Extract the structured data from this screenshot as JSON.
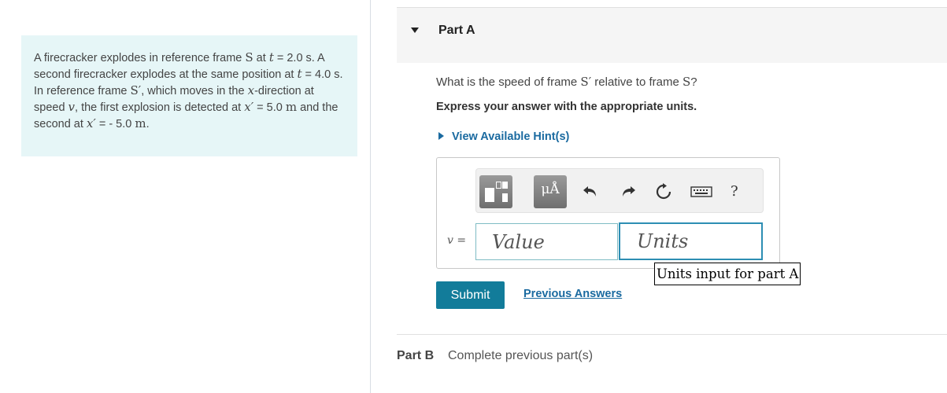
{
  "problem": {
    "segments": [
      {
        "t": "A firecracker explodes in reference frame ",
        "s": "text"
      },
      {
        "t": "S",
        "s": "math-roman"
      },
      {
        "t": " at ",
        "s": "text"
      },
      {
        "t": "t",
        "s": "math"
      },
      {
        "t": " = 2.0 s. A second firecracker explodes at the same position at ",
        "s": "text"
      },
      {
        "t": "t",
        "s": "math"
      },
      {
        "t": " = 4.0 s. In reference frame ",
        "s": "text"
      },
      {
        "t": "S′",
        "s": "math-roman"
      },
      {
        "t": ", which moves in the ",
        "s": "text"
      },
      {
        "t": "x",
        "s": "math"
      },
      {
        "t": "-direction at speed ",
        "s": "text"
      },
      {
        "t": "v",
        "s": "math"
      },
      {
        "t": ", the first explosion is detected at ",
        "s": "text"
      },
      {
        "t": "x′",
        "s": "math"
      },
      {
        "t": " = 5.0 ",
        "s": "text"
      },
      {
        "t": "m",
        "s": "math-roman"
      },
      {
        "t": " and the second at ",
        "s": "text"
      },
      {
        "t": "x′",
        "s": "math"
      },
      {
        "t": " = - 5.0 ",
        "s": "text"
      },
      {
        "t": "m",
        "s": "math-roman"
      },
      {
        "t": ".",
        "s": "text"
      }
    ]
  },
  "part_a": {
    "title": "Part A",
    "question_pre": "What is the speed of frame ",
    "frame_prime": "S′",
    "question_mid": " relative to frame ",
    "frame": "S",
    "question_post": "?",
    "instruction": "Express your answer with the appropriate units.",
    "hint_link": "View Available Hint(s)",
    "toolbar": {
      "units_button": "μÅ",
      "icons": [
        "templates-icon",
        "units-icon",
        "undo-icon",
        "redo-icon",
        "reset-icon",
        "keyboard-icon",
        "help-icon"
      ],
      "help_label": "?"
    },
    "answer": {
      "var_label": "v =",
      "value_placeholder": "Value",
      "units_placeholder": "Units",
      "units_tooltip": "Units input for part A"
    },
    "submit_label": "Submit",
    "previous_answers": "Previous Answers"
  },
  "part_b": {
    "label": "Part B",
    "status": "Complete previous part(s)"
  },
  "colors": {
    "problem_bg": "#e6f6f7",
    "link": "#1a6aa0",
    "submit_bg": "#127c9a",
    "units_border": "#2d8eb3"
  }
}
